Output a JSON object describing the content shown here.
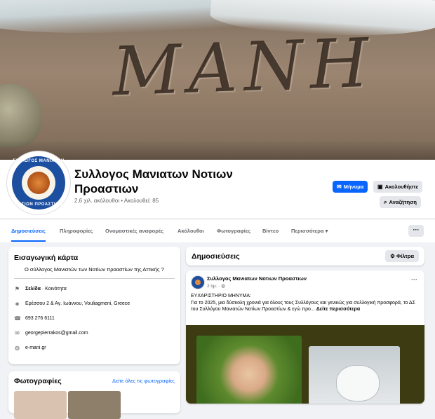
{
  "cover": {
    "sand_text": "ΜΑΝΗ"
  },
  "profile": {
    "avatar_top": "ΣΥΛΛΟΓΟΣ ΜΑΝΙΑΤΩΝ",
    "avatar_bottom": "ΝΟΤΙΩΝ ΠΡΟΑΣΤΙΩΝ",
    "name": "Συλλογος Μανιατων Νοτιων Προαστιων",
    "followers": "2,6 χιλ. ακόλουθοι • Ακολουθεί: 85"
  },
  "buttons": {
    "message": "Μήνυμα",
    "follow": "Ακολουθήστε",
    "search": "Αναζήτηση"
  },
  "tabs": [
    "Δημοσιεύσεις",
    "Πληροφορίες",
    "Ονομαστικές αναφορές",
    "Ακόλουθοι",
    "Φωτογραφίες",
    "Βίντεο",
    "Περισσότερα ▾"
  ],
  "more_dots": "···",
  "intro": {
    "title": "Εισαγωγική κάρτα",
    "quote": "Ο σύλλογος Μανιατών των Νοτίων προαστίων της Αττικής ?",
    "page_type_bold": "Σελίδα",
    "page_type_rest": " · Κοινότητα",
    "address": "Ερέσσου 2 & Αγ. Ιωάννου, Vouliagmeni, Greece",
    "phone": "693 276 6111",
    "email": "georgepierrakos@gmail.com",
    "website": "e-mani.gr"
  },
  "photos": {
    "title": "Φωτογραφίες",
    "see_all": "Δείτε όλες τις φωτογραφίες"
  },
  "posts": {
    "title": "Δημοσιεύσεις",
    "filters": "Φίλτρα"
  },
  "post": {
    "author": "Συλλογος Μανιατων Νοτιων Προαστιων",
    "time": "2 ημ. · ",
    "line1": "ΕΥΧΑΡΙΣΤΗΡΙΟ ΜΗΝΥΜΑ:",
    "line2": "Για το 2025, μια δύσκολη χρονιά για όλους τους Συλλόγους και γενικώς για συλλογική προσφορά, το ΔΣ του Συλλόγου Μανιατών Νοτίων Προαστίων & εγώ προ... ",
    "see_more": "Δείτε περισσότερα"
  },
  "colors": {
    "accent": "#0866ff",
    "background": "#f0f2f5"
  }
}
